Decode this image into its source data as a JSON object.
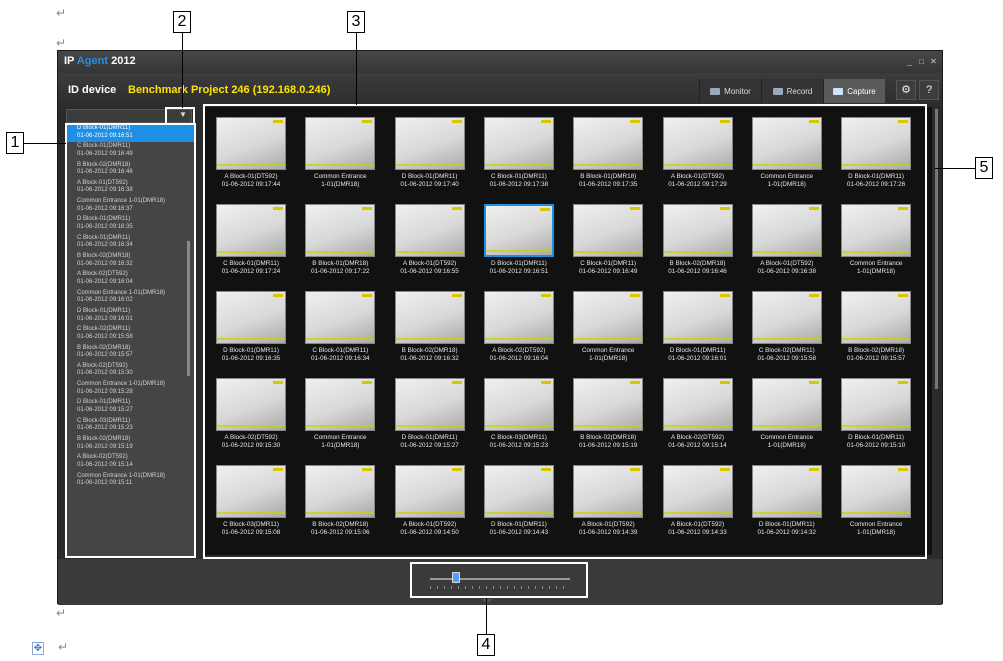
{
  "app": {
    "title_ip": "IP",
    "title_agent": "Agent",
    "title_year": "2012",
    "window_buttons": [
      "_",
      "□",
      "✕"
    ]
  },
  "header": {
    "id_device_label": "ID  device",
    "project_label": "Benchmark Project  246 (192.168.0.246)",
    "tabs": [
      {
        "label": "Monitor",
        "icon": "monitor-icon",
        "active": false
      },
      {
        "label": "Record",
        "icon": "record-icon",
        "active": false
      },
      {
        "label": "Capture",
        "icon": "capture-icon",
        "active": true
      }
    ],
    "settings_glyph": "⚙",
    "help_glyph": "?"
  },
  "list": {
    "filter_glyph": "▼",
    "items": [
      {
        "name": "D Block-01(DMR11)",
        "time": "01-06-2012 09:16:51",
        "selected": true
      },
      {
        "name": "C Block-01(DMR11)",
        "time": "01-06-2012 09:16:49"
      },
      {
        "name": "B Block-02(DMR18)",
        "time": "01-06-2012 09:16:46"
      },
      {
        "name": "A Block-01(DT592)",
        "time": "01-06-2012 09:16:38"
      },
      {
        "name": "Common Entrance 1-01(DMR18)",
        "time": "01-06-2012 09:16:37"
      },
      {
        "name": "D Block-01(DMR11)",
        "time": "01-06-2012 09:16:35"
      },
      {
        "name": "C Block-01(DMR11)",
        "time": "01-06-2012 09:16:34"
      },
      {
        "name": "B Block-02(DMR18)",
        "time": "01-06-2012 09:16:32"
      },
      {
        "name": "A Block-02(DT592)",
        "time": "01-06-2012 09:16:04"
      },
      {
        "name": "Common Entrance 1-01(DMR18)",
        "time": "01-06-2012 09:16:02"
      },
      {
        "name": "D Block-01(DMR11)",
        "time": "01-06-2012 09:16:01"
      },
      {
        "name": "C Block-02(DMR11)",
        "time": "01-06-2012 09:15:58"
      },
      {
        "name": "B Block-02(DMR18)",
        "time": "01-06-2012 09:15:57"
      },
      {
        "name": "A Block-02(DT592)",
        "time": "01-06-2012 09:15:30"
      },
      {
        "name": "Common Entrance 1-01(DMR18)",
        "time": "01-06-2012 09:15:28"
      },
      {
        "name": "D Block-01(DMR11)",
        "time": "01-06-2012 09:15:27"
      },
      {
        "name": "C Block-03(DMR11)",
        "time": "01-06-2012 09:15:23"
      },
      {
        "name": "B Block-02(DMR18)",
        "time": "01-06-2012 09:15:19"
      },
      {
        "name": "A Block-02(DT592)",
        "time": "01-06-2012 09:15:14"
      },
      {
        "name": "Common Entrance 1-01(DMR18)",
        "time": "01-06-2012 09:15:11"
      }
    ]
  },
  "grid": {
    "items": [
      {
        "l1": "A Block-01(DT592)",
        "l2": "01-06-2012 09:17:44"
      },
      {
        "l1": "Common Entrance",
        "l2": "1-01(DMR18)"
      },
      {
        "l1": "D Block-01(DMR11)",
        "l2": "01-06-2012 09:17:40"
      },
      {
        "l1": "C Block-01(DMR11)",
        "l2": "01-06-2012 09:17:38"
      },
      {
        "l1": "B Block-01(DMR18)",
        "l2": "01-06-2012 09:17:35"
      },
      {
        "l1": "A Block-01(DT592)",
        "l2": "01-06-2012 09:17:29"
      },
      {
        "l1": "Common Entrance",
        "l2": "1-01(DMR18)"
      },
      {
        "l1": "D Block-01(DMR11)",
        "l2": "01-06-2012 09:17:26"
      },
      {
        "l1": "C Block-01(DMR11)",
        "l2": "01-06-2012 09:17:24"
      },
      {
        "l1": "B Block-01(DMR18)",
        "l2": "01-06-2012 09:17:22"
      },
      {
        "l1": "A Block-01(DT592)",
        "l2": "01-06-2012 09:16:55"
      },
      {
        "l1": "D Block-01(DMR11)",
        "l2": "01-06-2012 09:16:51",
        "selected": true
      },
      {
        "l1": "C Block-01(DMR11)",
        "l2": "01-06-2012 09:16:49"
      },
      {
        "l1": "B Block-02(DMR18)",
        "l2": "01-06-2012 09:16:46"
      },
      {
        "l1": "A Block-01(DT592)",
        "l2": "01-06-2012 09:16:38"
      },
      {
        "l1": "Common Entrance",
        "l2": "1-01(DMR18)"
      },
      {
        "l1": "D Block-01(DMR11)",
        "l2": "01-06-2012 09:16:35"
      },
      {
        "l1": "C Block-01(DMR11)",
        "l2": "01-06-2012 09:16:34"
      },
      {
        "l1": "B Block-02(DMR18)",
        "l2": "01-06-2012 09:16:32"
      },
      {
        "l1": "A Block-02(DT592)",
        "l2": "01-06-2012 09:16:04"
      },
      {
        "l1": "Common Entrance",
        "l2": "1-01(DMR18)"
      },
      {
        "l1": "D Block-01(DMR11)",
        "l2": "01-06-2012 09:16:01"
      },
      {
        "l1": "C Block-02(DMR11)",
        "l2": "01-06-2012 09:15:58"
      },
      {
        "l1": "B Block-02(DMR18)",
        "l2": "01-06-2012 09:15:57"
      },
      {
        "l1": "A Block-02(DT592)",
        "l2": "01-06-2012 09:15:30"
      },
      {
        "l1": "Common Entrance",
        "l2": "1-01(DMR18)"
      },
      {
        "l1": "D Block-01(DMR11)",
        "l2": "01-06-2012 09:15:27"
      },
      {
        "l1": "C Block-03(DMR11)",
        "l2": "01-06-2012 09:15:23"
      },
      {
        "l1": "B Block-02(DMR18)",
        "l2": "01-06-2012 09:15:19"
      },
      {
        "l1": "A Block-02(DT592)",
        "l2": "01-06-2012 09:15:14"
      },
      {
        "l1": "Common Entrance",
        "l2": "1-01(DMR18)"
      },
      {
        "l1": "D Block-01(DMR11)",
        "l2": "01-06-2012 09:15:10"
      },
      {
        "l1": "C Block-03(DMR11)",
        "l2": "01-06-2012 09:15:08"
      },
      {
        "l1": "B Block-02(DMR18)",
        "l2": "01-06-2012 09:15:06"
      },
      {
        "l1": "A Block-01(DT592)",
        "l2": "01-06-2012 09:14:50"
      },
      {
        "l1": "D Block-01(DMR11)",
        "l2": "01-06-2012 09:14:43"
      },
      {
        "l1": "A Block-01(DT592)",
        "l2": "01-06-2012 09:14:39"
      },
      {
        "l1": "A Block-01(DT592)",
        "l2": "01-06-2012 09:14:33"
      },
      {
        "l1": "D Block-01(DMR11)",
        "l2": "01-06-2012 09:14:32"
      },
      {
        "l1": "Common Entrance",
        "l2": "1-01(DMR18)"
      }
    ]
  },
  "timeline": {
    "position": 0.17
  },
  "callouts": [
    {
      "number": "1",
      "target": "list-panel"
    },
    {
      "number": "2",
      "target": "filter-button"
    },
    {
      "number": "3",
      "target": "thumbnail-grid"
    },
    {
      "number": "4",
      "target": "zoom-slider"
    },
    {
      "number": "5",
      "target": "grid-scrollbar"
    }
  ],
  "doc_marks": {
    "paragraph": "↵",
    "move_handle": "✥"
  },
  "colors": {
    "accent": "#1f8fe6",
    "project_text": "#ffe400",
    "background": "#2b2b2b"
  }
}
